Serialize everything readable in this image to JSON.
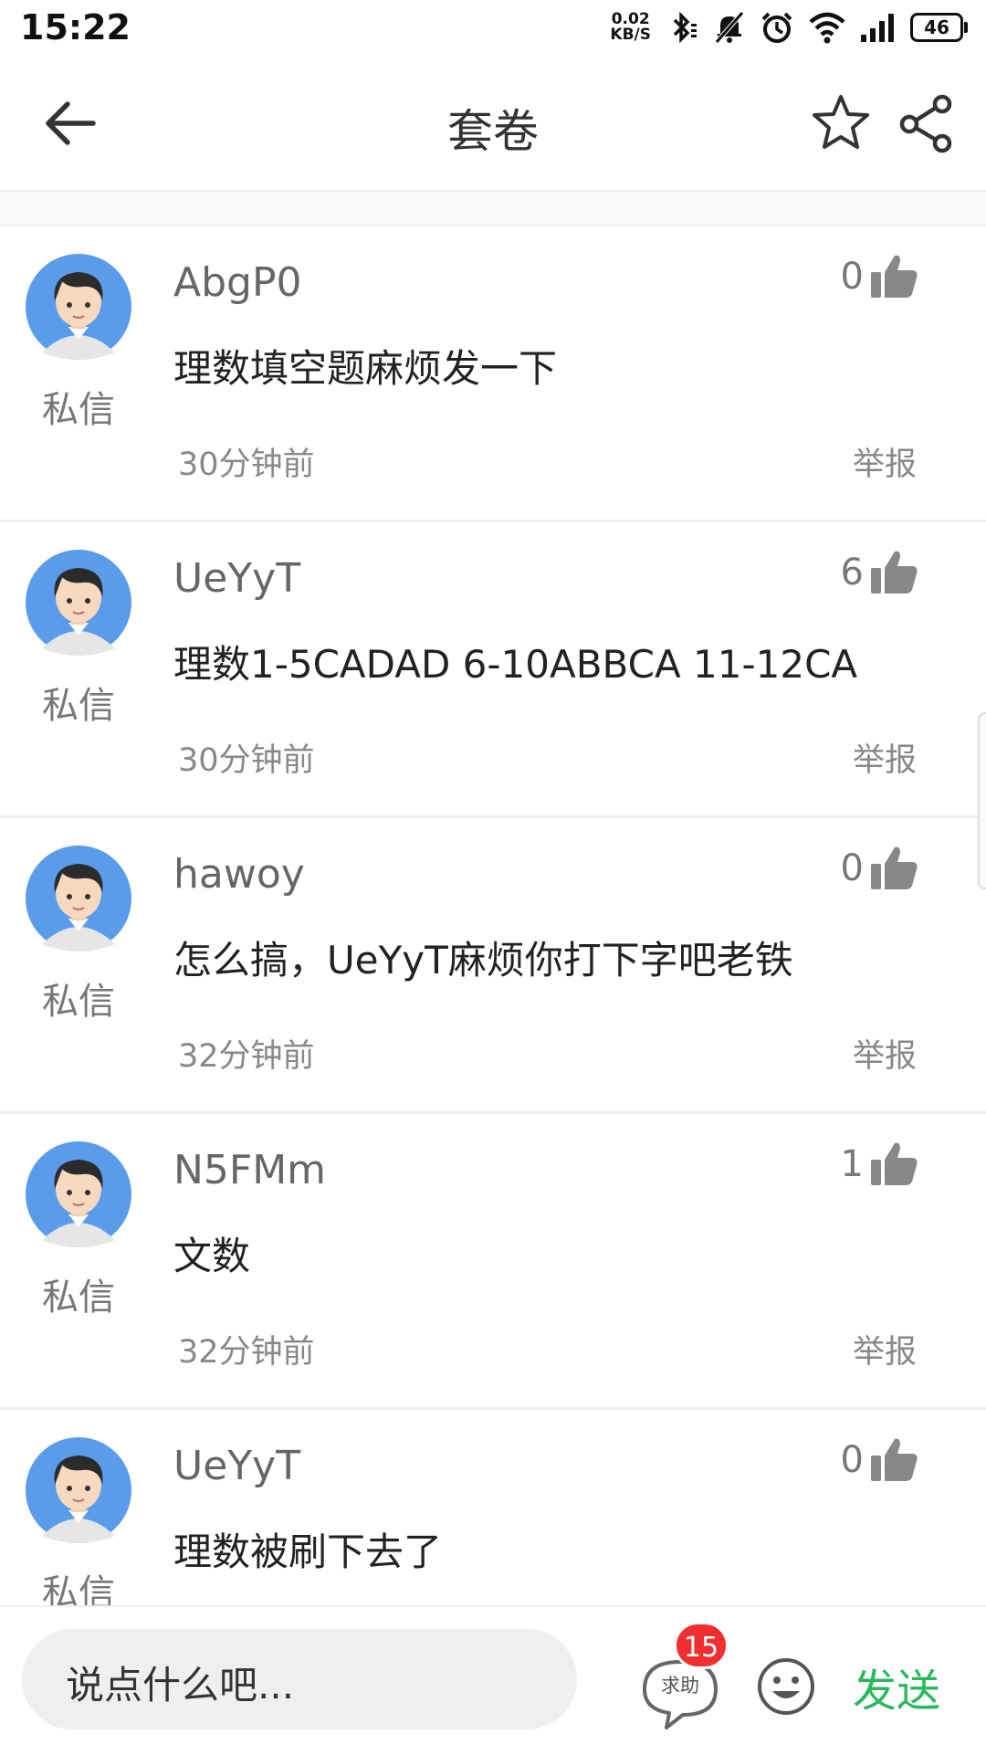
{
  "status_bar": {
    "time": "15:22",
    "net_speed_value": "0.02",
    "net_speed_unit": "KB/S",
    "battery": "46"
  },
  "nav": {
    "title": "套卷",
    "back_icon": "arrow-left-icon",
    "star_icon": "star-outline-icon",
    "share_icon": "share-icon"
  },
  "comments": [
    {
      "username": "AbgP0",
      "content": "理数填空题麻烦发一下",
      "time": "30分钟前",
      "likes": "0",
      "pm": "私信",
      "report": "举报"
    },
    {
      "username": "UeYyT",
      "content": "理数1-5CADAD 6-10ABBCA 11-12CA",
      "time": "30分钟前",
      "likes": "6",
      "pm": "私信",
      "report": "举报"
    },
    {
      "username": "hawoy",
      "content": "怎么搞，UeYyT麻烦你打下字吧老铁",
      "time": "32分钟前",
      "likes": "0",
      "pm": "私信",
      "report": "举报"
    },
    {
      "username": "N5FMm",
      "content": "文数",
      "time": "32分钟前",
      "likes": "1",
      "pm": "私信",
      "report": "举报"
    },
    {
      "username": "UeYyT",
      "content": "理数被刷下去了",
      "time": "",
      "likes": "0",
      "pm": "私信",
      "report": ""
    }
  ],
  "bottom_bar": {
    "input_placeholder": "说点什么吧...",
    "help_label": "求助",
    "help_badge": "15",
    "send_label": "发送"
  },
  "colors": {
    "send": "#2bb85c",
    "badge": "#ef2f2f",
    "avatar_bg": "#5a9bea"
  }
}
